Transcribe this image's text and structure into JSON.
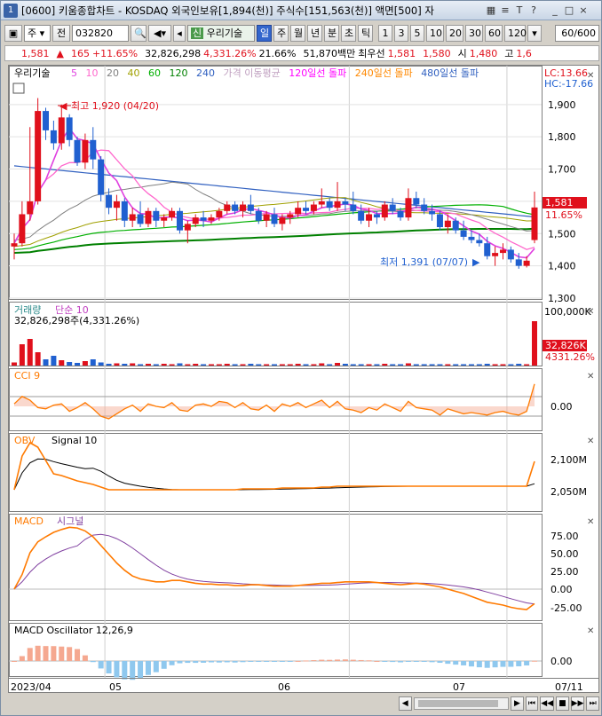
{
  "titlebar": {
    "window_num": "1",
    "title": "[0600] 키움종합차트 - KOSDAQ 외국인보유[1,894(천)] 주식수[151,563(천)] 액면[500] 자",
    "icons": [
      "grid-icon",
      "bars-icon",
      "t-icon",
      "help-icon"
    ],
    "window_controls": [
      "minimize-icon",
      "restore-icon",
      "close-icon"
    ]
  },
  "toolbar": {
    "code_type": "주",
    "prev": "전",
    "code": "032820",
    "name": "우리기술",
    "periods": [
      "일",
      "주",
      "월",
      "년",
      "분",
      "초",
      "틱"
    ],
    "active_period": "일",
    "intervals": [
      "1",
      "3",
      "5",
      "10",
      "20",
      "30",
      "60",
      "120"
    ],
    "count": "60/600"
  },
  "quote": {
    "price": "1,581",
    "arrow": "▲",
    "change": "165",
    "change_pct": "+11.65%",
    "volume": "32,826,298",
    "volume_pct": "4,331.26%",
    "turnover": "21.66%",
    "amount": "51,870백만",
    "bid_label": "최우선",
    "bid": "1,581",
    "ask": "1,580",
    "open_label": "시",
    "open": "1,480",
    "high_label": "고",
    "high": "1,6"
  },
  "legend": {
    "name": "우리기술",
    "ma": [
      {
        "label": "5",
        "color": "#e040e0"
      },
      {
        "label": "10",
        "color": "#ff66cc"
      },
      {
        "label": "20",
        "color": "#808080"
      },
      {
        "label": "40",
        "color": "#a0a000"
      },
      {
        "label": "60",
        "color": "#00b000"
      },
      {
        "label": "120",
        "color": "#008000"
      },
      {
        "label": "240",
        "color": "#3060c0"
      }
    ],
    "ma_title": "가격 이동평균",
    "breakouts": [
      {
        "label": "120일선 돌파",
        "color": "#ff00ff"
      },
      {
        "label": "240일선 돌파",
        "color": "#ff8800"
      },
      {
        "label": "480일선 돌파",
        "color": "#3060c0"
      }
    ],
    "lc": "LC:13.66",
    "hc": "HC:-17.66"
  },
  "colors": {
    "up": "#e0101c",
    "down": "#2060d0",
    "orange": "#ff7a00",
    "purple": "#8040a0",
    "lightblue": "#8fc8ee",
    "salmon": "#f5a890"
  },
  "price_panel": {
    "y_ticks": [
      "1,900",
      "1,800",
      "1,700",
      "1,600",
      "1,500",
      "1,400",
      "1,300"
    ],
    "current_price": "1,581",
    "current_pct": "11.65%",
    "high_note": "최고 1,920 (04/20)",
    "low_note": "최저 1,391 (07/07)"
  },
  "volume_panel": {
    "title": "거래량",
    "ma_label": "단순 10",
    "value_text": "32,826,298주(4,331.26%)",
    "y_tick": "100,000K",
    "last_label": "32,826K",
    "last_pct": "4331.26%"
  },
  "cci_panel": {
    "title": "CCI 9",
    "y_tick": "0.00"
  },
  "obv_panel": {
    "title": "OBV",
    "signal": "Signal 10",
    "y_ticks": [
      "2,100M",
      "2,050M"
    ]
  },
  "macd_panel": {
    "title": "MACD",
    "signal": "시그널",
    "y_ticks": [
      "75.00",
      "50.00",
      "25.00",
      "0.00",
      "-25.00"
    ]
  },
  "osc_panel": {
    "title": "MACD Oscillator 12,26,9",
    "y_tick": "0.00"
  },
  "x_axis": {
    "labels": [
      "2023/04",
      "05",
      "06",
      "07",
      "07/11"
    ]
  },
  "chart_data": {
    "type": "candlestick",
    "ylim": [
      1300,
      1960
    ],
    "candles": [
      [
        1460,
        1500,
        1420,
        1470
      ],
      [
        1470,
        1600,
        1460,
        1560
      ],
      [
        1560,
        1830,
        1540,
        1600
      ],
      [
        1600,
        1920,
        1590,
        1880
      ],
      [
        1880,
        1890,
        1790,
        1820
      ],
      [
        1820,
        1850,
        1760,
        1780
      ],
      [
        1780,
        1900,
        1760,
        1860
      ],
      [
        1860,
        1870,
        1770,
        1790
      ],
      [
        1790,
        1800,
        1710,
        1720
      ],
      [
        1720,
        1810,
        1700,
        1790
      ],
      [
        1790,
        1830,
        1700,
        1730
      ],
      [
        1730,
        1740,
        1600,
        1620
      ],
      [
        1620,
        1640,
        1560,
        1580
      ],
      [
        1580,
        1620,
        1540,
        1600
      ],
      [
        1600,
        1610,
        1520,
        1540
      ],
      [
        1540,
        1580,
        1520,
        1560
      ],
      [
        1560,
        1600,
        1520,
        1530
      ],
      [
        1530,
        1580,
        1520,
        1570
      ],
      [
        1570,
        1580,
        1520,
        1540
      ],
      [
        1540,
        1560,
        1520,
        1550
      ],
      [
        1550,
        1580,
        1540,
        1570
      ],
      [
        1570,
        1580,
        1500,
        1510
      ],
      [
        1510,
        1540,
        1470,
        1530
      ],
      [
        1530,
        1560,
        1520,
        1550
      ],
      [
        1550,
        1570,
        1520,
        1540
      ],
      [
        1540,
        1560,
        1530,
        1550
      ],
      [
        1550,
        1580,
        1540,
        1570
      ],
      [
        1570,
        1600,
        1560,
        1590
      ],
      [
        1590,
        1600,
        1560,
        1570
      ],
      [
        1570,
        1600,
        1550,
        1590
      ],
      [
        1590,
        1620,
        1560,
        1570
      ],
      [
        1570,
        1580,
        1530,
        1540
      ],
      [
        1540,
        1570,
        1520,
        1560
      ],
      [
        1560,
        1580,
        1520,
        1530
      ],
      [
        1530,
        1560,
        1510,
        1550
      ],
      [
        1550,
        1570,
        1530,
        1560
      ],
      [
        1560,
        1600,
        1550,
        1580
      ],
      [
        1580,
        1600,
        1560,
        1570
      ],
      [
        1570,
        1600,
        1560,
        1590
      ],
      [
        1590,
        1640,
        1580,
        1600
      ],
      [
        1600,
        1610,
        1570,
        1580
      ],
      [
        1580,
        1660,
        1570,
        1600
      ],
      [
        1600,
        1610,
        1570,
        1590
      ],
      [
        1590,
        1630,
        1560,
        1570
      ],
      [
        1570,
        1590,
        1530,
        1540
      ],
      [
        1540,
        1580,
        1520,
        1560
      ],
      [
        1560,
        1570,
        1530,
        1550
      ],
      [
        1550,
        1600,
        1540,
        1590
      ],
      [
        1590,
        1610,
        1560,
        1570
      ],
      [
        1570,
        1580,
        1540,
        1550
      ],
      [
        1550,
        1640,
        1540,
        1610
      ],
      [
        1610,
        1630,
        1580,
        1590
      ],
      [
        1590,
        1610,
        1560,
        1570
      ],
      [
        1570,
        1590,
        1540,
        1560
      ],
      [
        1560,
        1570,
        1510,
        1520
      ],
      [
        1520,
        1560,
        1500,
        1540
      ],
      [
        1540,
        1550,
        1500,
        1510
      ],
      [
        1510,
        1540,
        1480,
        1490
      ],
      [
        1490,
        1510,
        1470,
        1480
      ],
      [
        1480,
        1500,
        1460,
        1470
      ],
      [
        1470,
        1490,
        1420,
        1430
      ],
      [
        1430,
        1460,
        1400,
        1440
      ],
      [
        1440,
        1470,
        1420,
        1450
      ],
      [
        1450,
        1460,
        1410,
        1420
      ],
      [
        1420,
        1440,
        1391,
        1400
      ],
      [
        1400,
        1430,
        1395,
        1416
      ],
      [
        1480,
        1630,
        1470,
        1581
      ]
    ]
  }
}
